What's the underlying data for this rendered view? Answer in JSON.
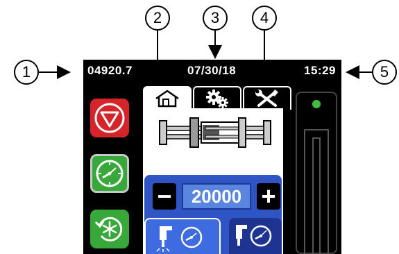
{
  "callouts": [
    "1",
    "2",
    "3",
    "4",
    "5"
  ],
  "status_bar": {
    "counter": "04920.7",
    "date": "07/30/18",
    "time": "15:29"
  },
  "tabs": [
    {
      "name": "home",
      "icon": "home-icon",
      "active": true
    },
    {
      "name": "settings",
      "icon": "gears-icon",
      "active": false
    },
    {
      "name": "tools",
      "icon": "wrench-screwdriver-icon",
      "active": false
    }
  ],
  "left_buttons": [
    {
      "name": "stop",
      "icon": "stop-icon",
      "color": "#d6242b"
    },
    {
      "name": "run",
      "icon": "gauge-icon",
      "color": "#38a83a",
      "selected": true
    },
    {
      "name": "defrost",
      "icon": "snowflake-cycle-icon",
      "color": "#38a83a"
    }
  ],
  "quantity": {
    "minus": "−",
    "value": "20000",
    "plus": "+"
  },
  "mode_buttons": [
    {
      "name": "dispense-timed",
      "icon": "dispense-gauge-icon",
      "active": true
    },
    {
      "name": "dispense-manual",
      "icon": "dispense-gauge-icon",
      "active": false
    }
  ],
  "colors": {
    "screen_bg": "#000000",
    "accent_blue": "#2f55c4",
    "value_blue": "#5a86e0",
    "stop_red": "#d6242b",
    "run_green": "#38a83a",
    "indicator_green": "#3fbf3f"
  }
}
